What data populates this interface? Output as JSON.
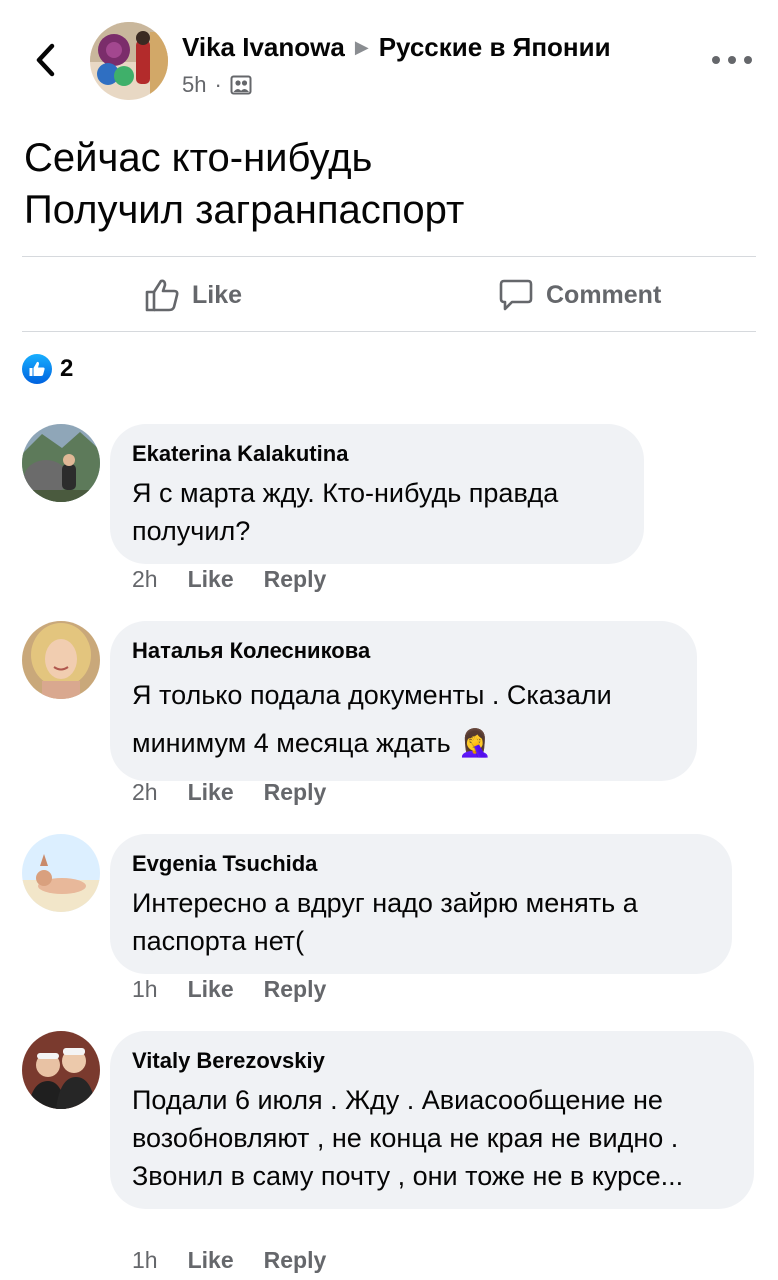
{
  "post": {
    "author": "Vika Ivanowa",
    "group": "Русские в Японии",
    "time": "5h",
    "text_line1": "Сейчас кто-нибудь",
    "text_line2": "Получил загранпаспорт",
    "like_label": "Like",
    "comment_label": "Comment",
    "reaction_count": "2"
  },
  "comments": [
    {
      "name": "Ekaterina Kalakutina",
      "text": "Я с марта жду. Кто-нибудь правда получил?",
      "time": "2h",
      "like": "Like",
      "reply": "Reply"
    },
    {
      "name": "Наталья Колесникова",
      "text": "Я только подала документы . Сказали минимум 4 месяца ждать 🤦‍♀️",
      "time": "2h",
      "like": "Like",
      "reply": "Reply"
    },
    {
      "name": "Evgenia Tsuchida",
      "text": "Интересно а вдруг надо зайрю менять а паспорта нет(",
      "time": "1h",
      "like": "Like",
      "reply": "Reply"
    },
    {
      "name": "Vitaly Berezovskiy",
      "text": "Подали 6 июля . Жду . Авиасообщение не возобновляют , не конца не края не видно . Звонил в саму почту , они тоже не в курсе...",
      "time": "1h",
      "like": "Like",
      "reply": "Reply"
    }
  ],
  "colors": {
    "bubble": "#f0f2f5",
    "secondary_text": "#65676b",
    "like_blue": "#1877f2"
  }
}
